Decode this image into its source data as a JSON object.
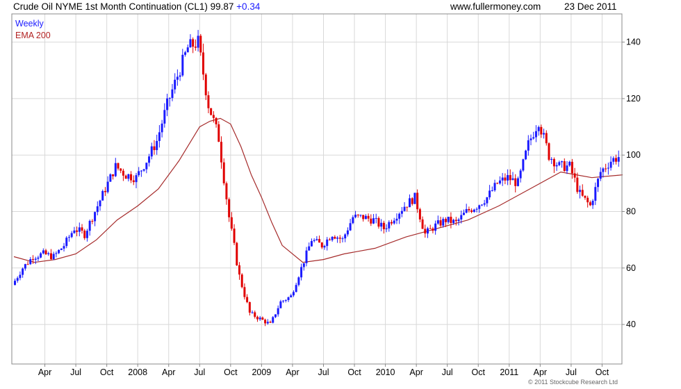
{
  "header": {
    "title": "Crude Oil NYME 1st Month Continuation (CL1) 99.87",
    "change": "+0.34",
    "site": "www.fullermoney.com",
    "date": "23 Dec 2011"
  },
  "legend": {
    "weekly": "Weekly",
    "ema": "EMA 200"
  },
  "copyright": "© 2011 Stockcube Research Ltd",
  "colors": {
    "up": "#1a1aff",
    "down": "#e00000",
    "ema": "#a52a2a",
    "grid": "#d8d8d8"
  },
  "chart_data": {
    "type": "candlestick",
    "title": "Crude Oil NYME 1st Month Continuation (CL1) 99.87 +0.34",
    "ylim": [
      26,
      150
    ],
    "y_ticks": [
      40,
      60,
      80,
      100,
      120,
      140
    ],
    "x_ticks": [
      "Apr",
      "Jul",
      "Oct",
      "2008",
      "Apr",
      "Jul",
      "Oct",
      "2009",
      "Apr",
      "Jul",
      "Oct",
      "2010",
      "Apr",
      "Jul",
      "Oct",
      "2011",
      "Apr",
      "Jul",
      "Oct"
    ],
    "grid": true,
    "series": [
      {
        "name": "Weekly",
        "style": "candles",
        "x": [
          "2007-01",
          "2007-02",
          "2007-03",
          "2007-04",
          "2007-05",
          "2007-06",
          "2007-07",
          "2007-08",
          "2007-09",
          "2007-10",
          "2007-11",
          "2007-12",
          "2008-01",
          "2008-02",
          "2008-03",
          "2008-04",
          "2008-05",
          "2008-06",
          "2008-07",
          "2008-08",
          "2008-09",
          "2008-10",
          "2008-11",
          "2008-12",
          "2009-01",
          "2009-02",
          "2009-03",
          "2009-04",
          "2009-05",
          "2009-06",
          "2009-07",
          "2009-08",
          "2009-09",
          "2009-10",
          "2009-11",
          "2009-12",
          "2010-01",
          "2010-02",
          "2010-03",
          "2010-04",
          "2010-05",
          "2010-06",
          "2010-07",
          "2010-08",
          "2010-09",
          "2010-10",
          "2010-11",
          "2010-12",
          "2011-01",
          "2011-02",
          "2011-03",
          "2011-04",
          "2011-05",
          "2011-06",
          "2011-07",
          "2011-08",
          "2011-09",
          "2011-10",
          "2011-11",
          "2011-12"
        ],
        "values": [
          54,
          60,
          64,
          65,
          64,
          68,
          74,
          72,
          80,
          88,
          96,
          93,
          92,
          98,
          105,
          118,
          128,
          138,
          140,
          118,
          106,
          78,
          57,
          44,
          42,
          40,
          48,
          50,
          60,
          70,
          68,
          72,
          70,
          78,
          78,
          77,
          74,
          78,
          82,
          85,
          72,
          75,
          77,
          76,
          80,
          82,
          85,
          90,
          92,
          90,
          104,
          112,
          100,
          96,
          96,
          86,
          82,
          94,
          98,
          99.87
        ]
      },
      {
        "name": "EMA 200",
        "style": "line",
        "x": [
          "2007-01",
          "2007-03",
          "2007-05",
          "2007-07",
          "2007-09",
          "2007-11",
          "2008-01",
          "2008-03",
          "2008-05",
          "2008-07",
          "2008-08",
          "2008-09",
          "2008-10",
          "2008-11",
          "2008-12",
          "2009-01",
          "2009-02",
          "2009-03",
          "2009-05",
          "2009-07",
          "2009-09",
          "2009-12",
          "2010-03",
          "2010-06",
          "2010-09",
          "2010-12",
          "2011-03",
          "2011-06",
          "2011-09",
          "2011-12"
        ],
        "values": [
          64,
          62,
          63,
          65,
          70,
          77,
          82,
          88,
          98,
          110,
          112,
          113,
          111,
          103,
          93,
          85,
          76,
          68,
          62,
          63,
          65,
          67,
          71,
          74,
          77,
          82,
          88,
          94,
          92,
          93
        ]
      }
    ]
  }
}
